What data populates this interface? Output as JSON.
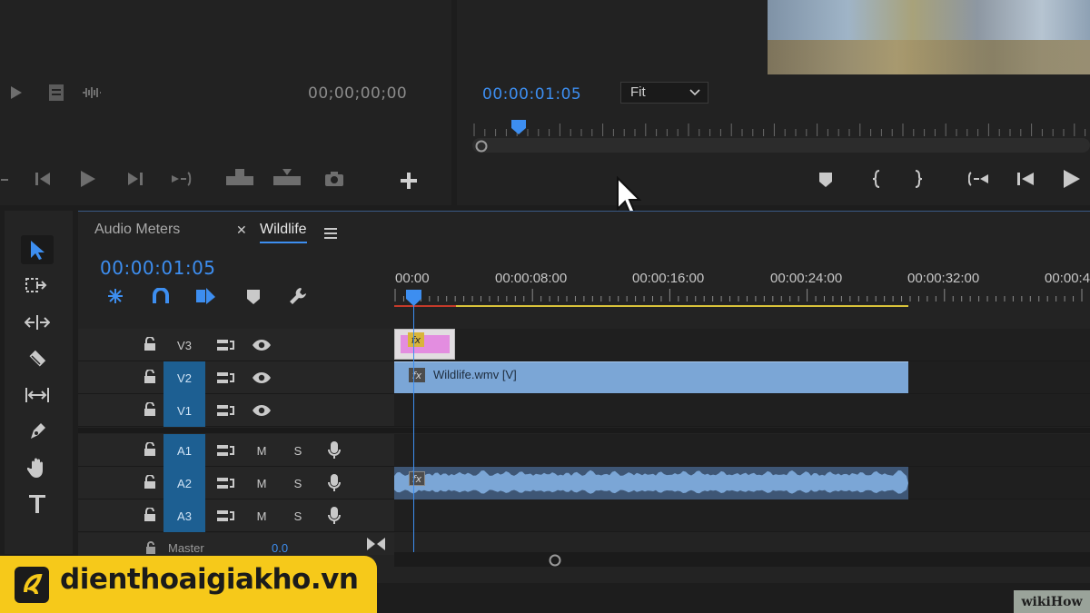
{
  "source_monitor": {
    "timecode": "00;00;00;00"
  },
  "program_monitor": {
    "timecode": "00:00:01:05",
    "zoom": "Fit"
  },
  "timeline": {
    "tabs": [
      {
        "label": "Audio Meters"
      },
      {
        "label": "Wildlife"
      }
    ],
    "timecode": "00:00:01:05",
    "ruler": [
      "00:00",
      "00:00:08:00",
      "00:00:16:00",
      "00:00:24:00",
      "00:00:32:00",
      "00:00:4"
    ],
    "video_tracks": [
      {
        "name": "V3",
        "targeted": false
      },
      {
        "name": "V2",
        "targeted": true
      },
      {
        "name": "V1",
        "targeted": true
      }
    ],
    "audio_tracks": [
      {
        "name": "A1",
        "mute": "M",
        "solo": "S"
      },
      {
        "name": "A2",
        "mute": "M",
        "solo": "S"
      },
      {
        "name": "A3",
        "mute": "M",
        "solo": "S"
      }
    ],
    "master": {
      "label": "Master",
      "value": "0.0"
    },
    "clips": {
      "video": "Wildlife.wmv [V]",
      "fx": "fx"
    }
  },
  "watermark": {
    "brand": "dienthoaigiakho.vn",
    "source": "wikiHow"
  },
  "colors": {
    "accent": "#3d8ef0",
    "clip_video": "#7ba6d6",
    "track_target": "#1d5f92",
    "brand": "#f6c91a"
  }
}
